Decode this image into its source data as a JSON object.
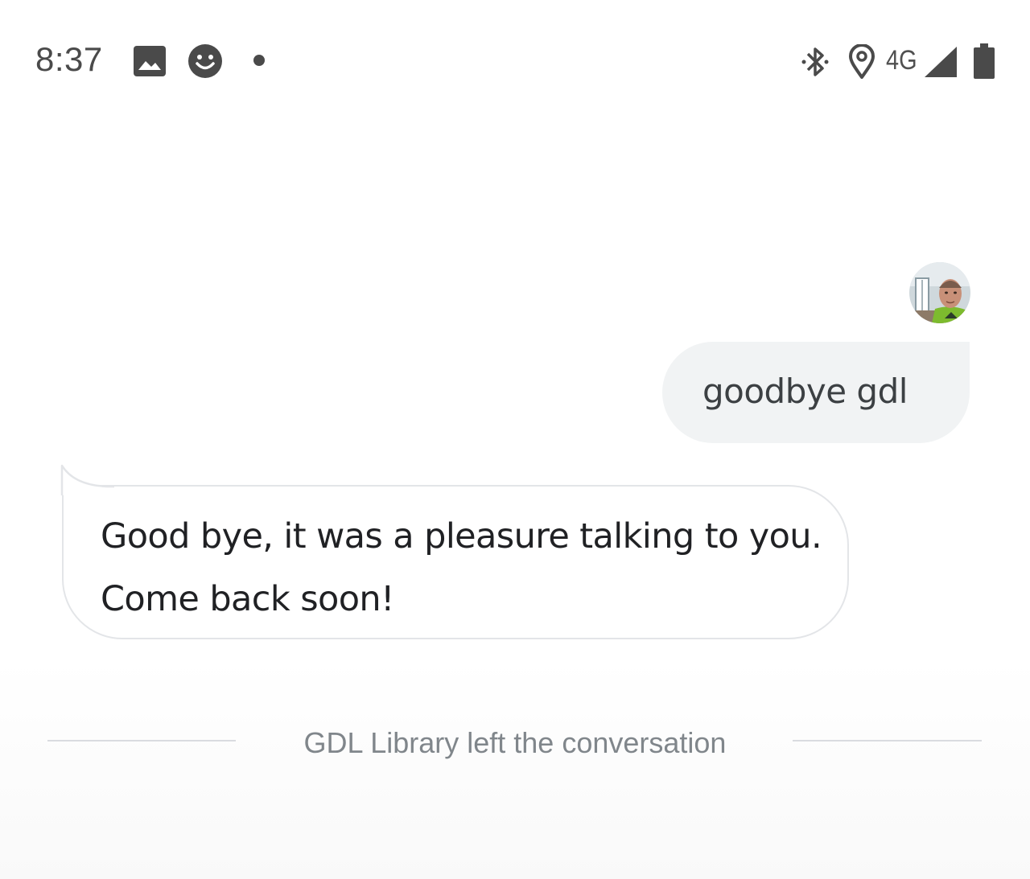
{
  "status_bar": {
    "time": "8:37",
    "network_label": "4G",
    "icons": [
      "image-icon",
      "smiley-icon",
      "notification-dot-icon",
      "bluetooth-icon",
      "location-icon",
      "signal-icon",
      "battery-icon"
    ],
    "text_color": "#4a4a4a"
  },
  "conversation": {
    "messages": [
      {
        "sender": "user",
        "text": "goodbye gdl"
      },
      {
        "sender": "bot",
        "text": "Good bye, it was a pleasure talking to you. Come back soon!"
      }
    ],
    "system_message": "GDL Library left the conversation"
  },
  "colors": {
    "outgoing_bubble": "#f1f3f4",
    "incoming_border": "#e3e5e8",
    "system_text": "#80868b"
  }
}
